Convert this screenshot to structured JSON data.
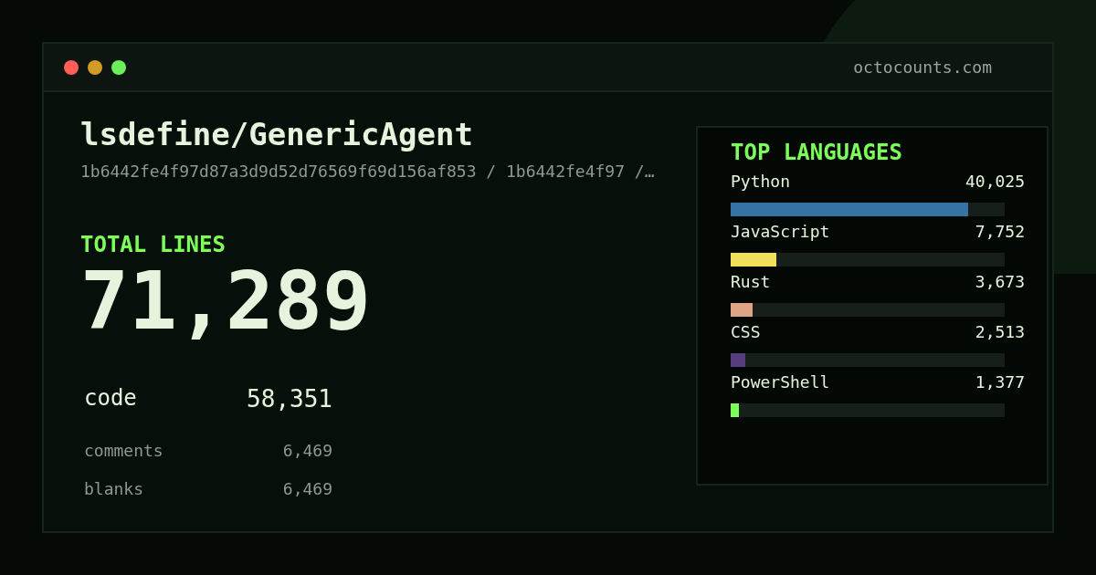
{
  "window": {
    "domain": "octocounts.com"
  },
  "repo": {
    "name": "lsdefine/GenericAgent",
    "path": "1b6442fe4f97d87a3d9d52d76569f69d156af853 / 1b6442fe4f97 /…"
  },
  "total": {
    "label": "TOTAL LINES",
    "value": "71,289"
  },
  "stats": [
    {
      "kind": "primary",
      "label": "code",
      "value": "58,351"
    },
    {
      "kind": "secondary",
      "label": "comments",
      "value": "6,469"
    },
    {
      "kind": "secondary",
      "label": "blanks",
      "value": "6,469"
    }
  ],
  "languages": {
    "title": "TOP LANGUAGES",
    "items": [
      {
        "name": "Python",
        "count": "40,025",
        "level": 0.867,
        "color": "#3572a5"
      },
      {
        "name": "JavaScript",
        "count": "7,752",
        "level": 0.167,
        "color": "#f1e05a"
      },
      {
        "name": "Rust",
        "count": "3,673",
        "level": 0.08,
        "color": "#dea584"
      },
      {
        "name": "CSS",
        "count": "2,513",
        "level": 0.053,
        "color": "#563d7c"
      },
      {
        "name": "PowerShell",
        "count": "1,377",
        "level": 0.03,
        "color": "#7cff5a"
      }
    ]
  }
}
